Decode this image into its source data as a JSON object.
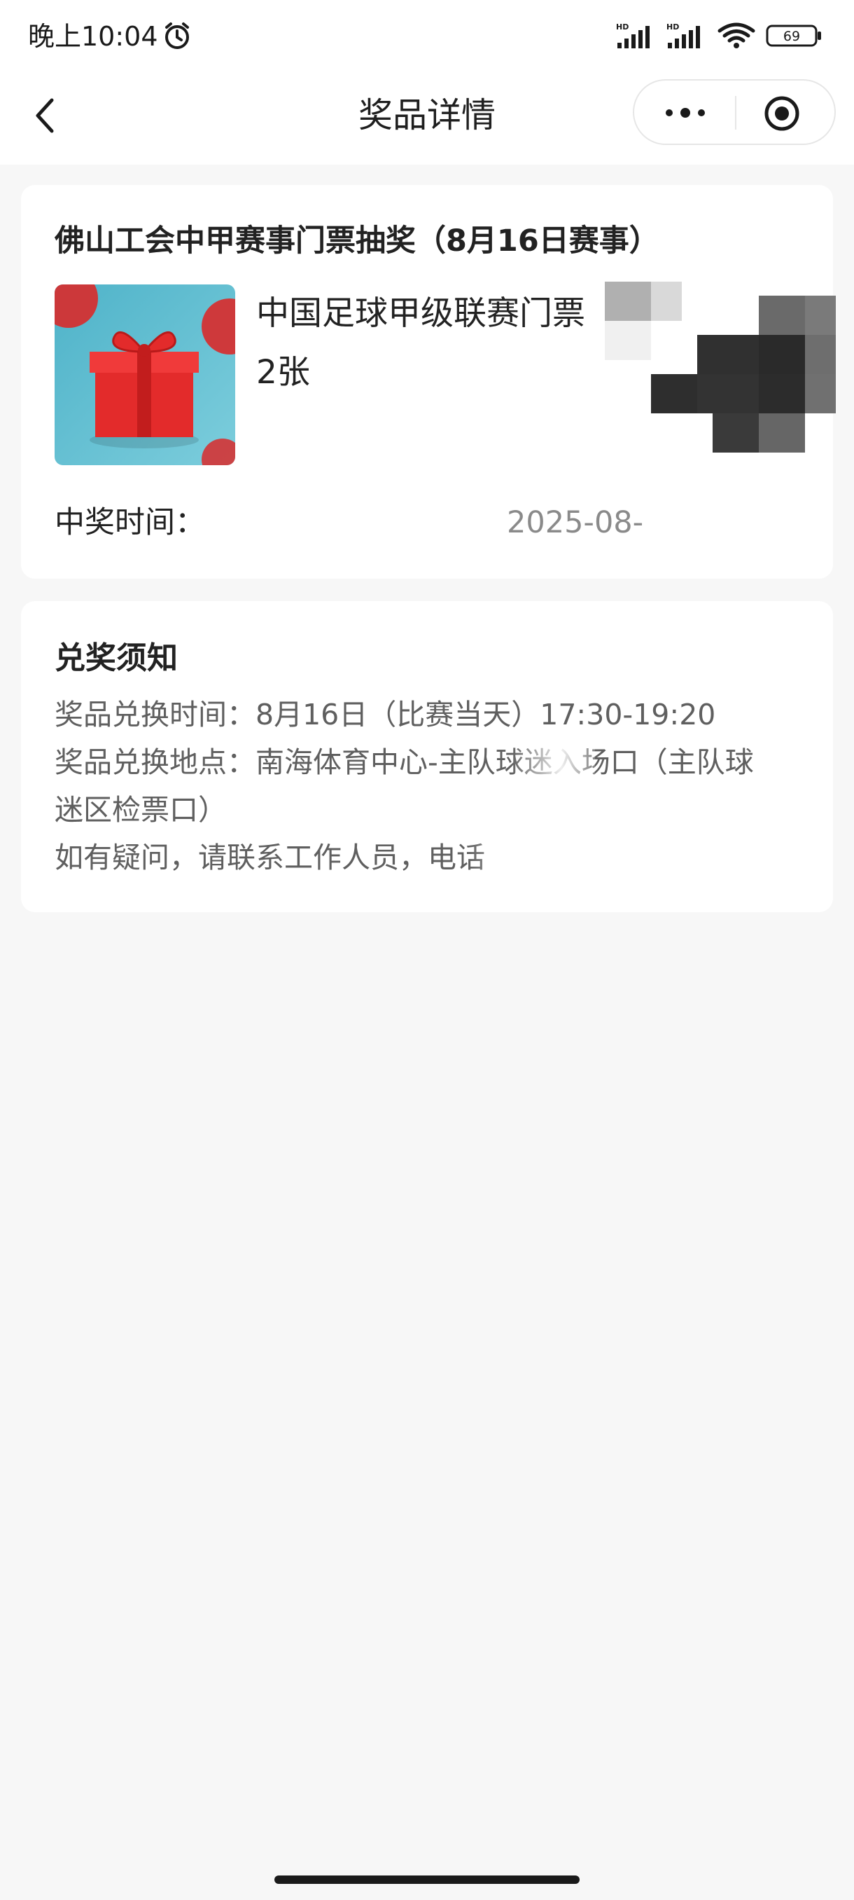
{
  "status_bar": {
    "time": "晚上10:04",
    "battery": "69",
    "icons": [
      "alarm-icon",
      "signal-hd-icon",
      "signal-hd-icon",
      "wifi-icon",
      "battery-icon"
    ]
  },
  "nav": {
    "title": "奖品详情",
    "back_icon": "chevron-left-icon",
    "more_icon": "more-dots-icon",
    "close_icon": "target-close-icon"
  },
  "prize": {
    "event_title": "佛山工会中甲赛事门票抽奖（8月16日赛事）",
    "name_line1": "中国足球甲级联赛门票",
    "name_line2": "2张",
    "image_icon": "gift-box-image",
    "win_time_label": "中奖时间：",
    "win_time_value": "2025-08-"
  },
  "notice": {
    "title": "兑奖须知",
    "line1": "奖品兑换时间：8月16日（比赛当天）17:30-19:20",
    "line2": "奖品兑换地点：南海体育中心-主队球迷入场口（主队球",
    "line3": "迷区检票口）",
    "line4": "如有疑问，请联系工作人员，电话"
  },
  "colors": {
    "background": "#f7f7f7",
    "card": "#ffffff",
    "gift_red": "#e32b2b",
    "gift_bg": "#56b6cc"
  }
}
